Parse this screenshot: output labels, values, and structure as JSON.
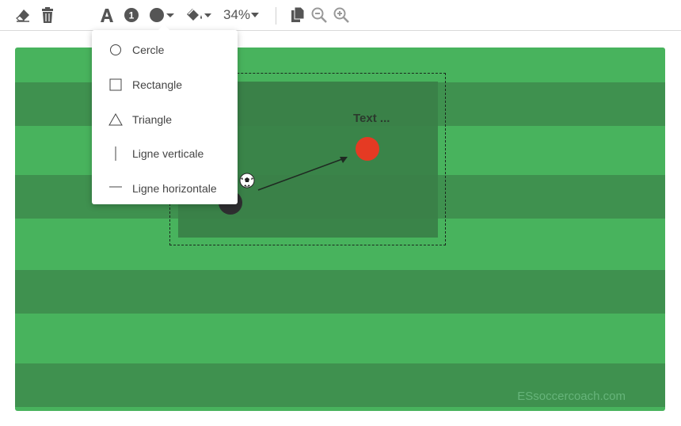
{
  "toolbar": {
    "zoom": "34%",
    "icons": [
      "eraser-icon",
      "trash-icon",
      "text-icon",
      "number-icon",
      "shape-circle-icon",
      "fill-icon",
      "copy-icon",
      "zoom-out-icon",
      "zoom-in-icon"
    ]
  },
  "shape_menu": {
    "items": [
      {
        "label": "Cercle",
        "icon": "circle-outline-icon"
      },
      {
        "label": "Rectangle",
        "icon": "square-outline-icon"
      },
      {
        "label": "Triangle",
        "icon": "triangle-outline-icon"
      },
      {
        "label": "Ligne verticale",
        "icon": "vertical-line-icon"
      },
      {
        "label": "Ligne horizontale",
        "icon": "horizontal-line-icon"
      }
    ]
  },
  "field": {
    "text_element": "Text ...",
    "watermark": "ESsoccercoach.com",
    "colors": {
      "light": "#48b35d",
      "dark": "#3f914f",
      "zone": "#3a8048",
      "red_player": "#e53a23",
      "dark_player": "#2e2e30"
    }
  }
}
